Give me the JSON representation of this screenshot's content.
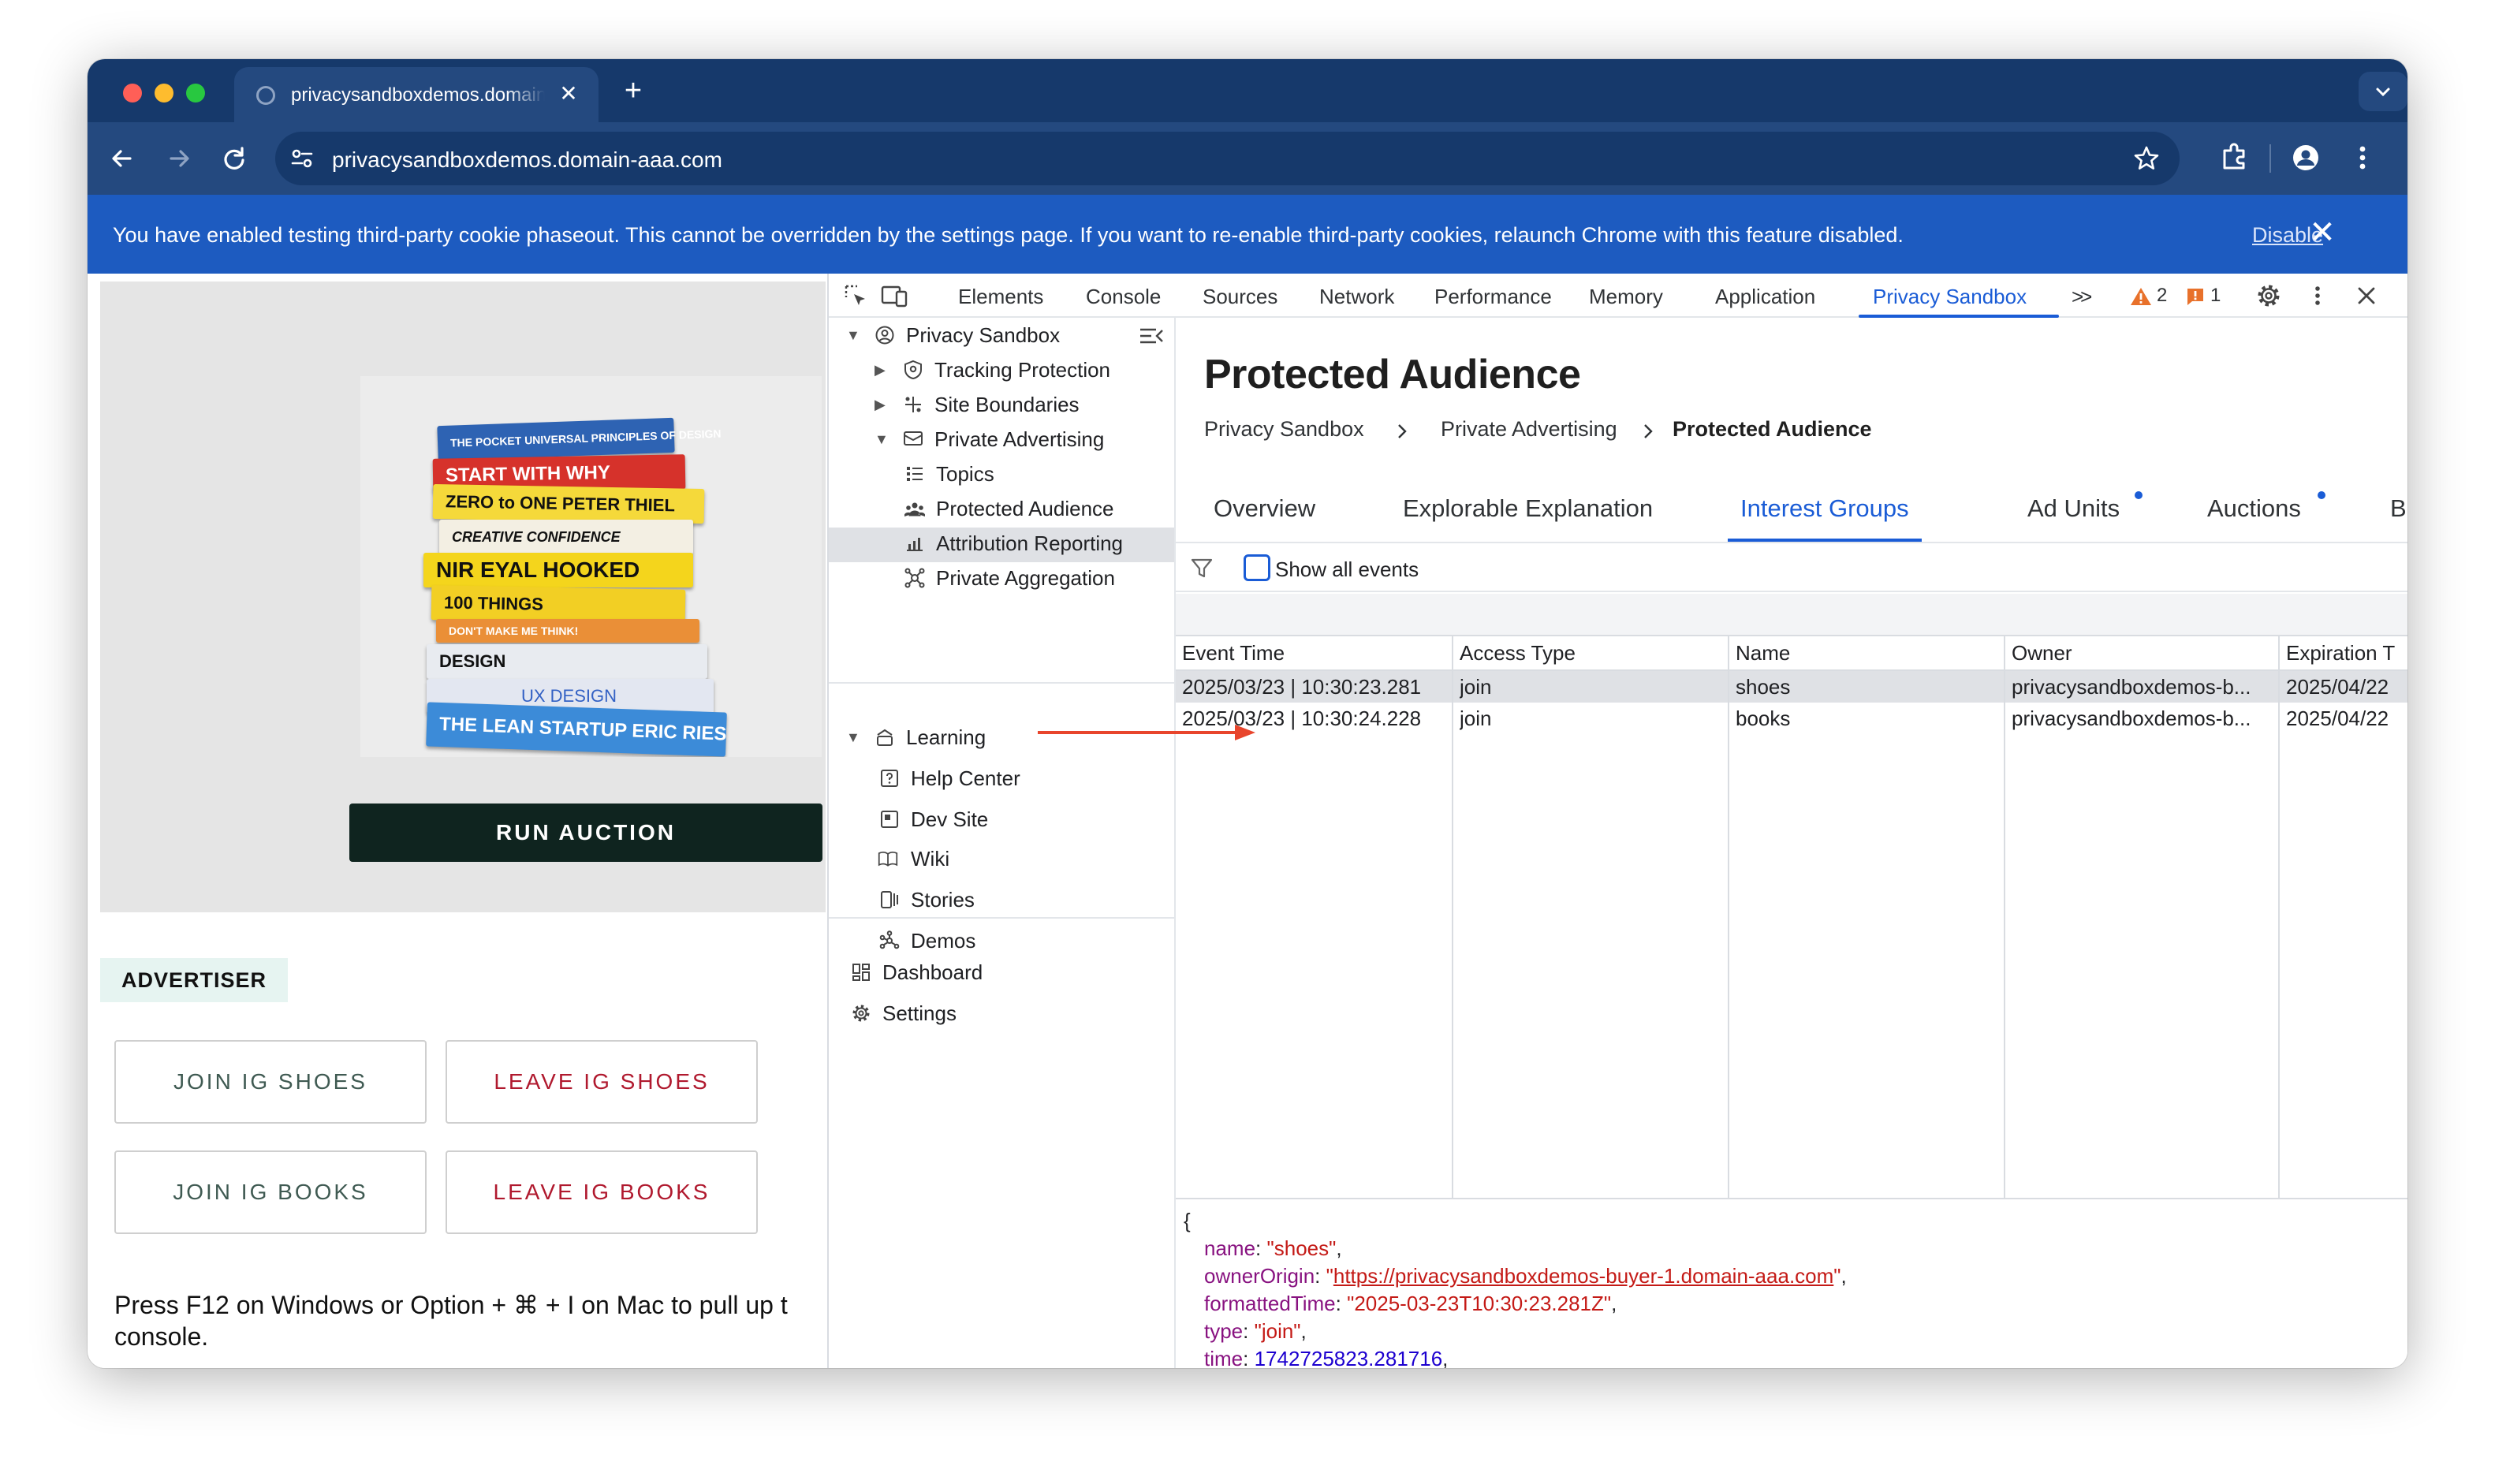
{
  "browser": {
    "tab_title": "privacysandboxdemos.domain-aaa.com",
    "url": "privacysandboxdemos.domain-aaa.com",
    "infobar_text": "You have enabled testing third-party cookie phaseout. This cannot be overridden by the settings page. If you want to re-enable third-party cookies, relaunch Chrome with this feature disabled.",
    "infobar_action": "Disable"
  },
  "page": {
    "books": [
      "THE POCKET UNIVERSAL PRINCIPLES OF DESIGN",
      "START WITH WHY",
      "ZERO to ONE   PETER THIEL",
      "CREATIVE CONFIDENCE",
      "NIR EYAL  HOOKED",
      "100 THINGS",
      "DON'T MAKE ME THINK!",
      "DESIGN",
      "UX DESIGN",
      "THE LEAN STARTUP  ERIC RIES"
    ],
    "run_auction": "RUN AUCTION",
    "advertiser_label": "ADVERTISER",
    "join_shoes": "JOIN IG SHOES",
    "leave_shoes": "LEAVE IG SHOES",
    "join_books": "JOIN IG BOOKS",
    "leave_books": "LEAVE IG BOOKS",
    "help_line1": "Press F12 on Windows or Option + ⌘ + I on Mac to pull up t",
    "help_line2": "console."
  },
  "devtools": {
    "tabs": [
      "Elements",
      "Console",
      "Sources",
      "Network",
      "Performance",
      "Memory",
      "Application",
      "Privacy Sandbox"
    ],
    "more_tabs": ">>",
    "warnings_count": "2",
    "issues_count": "1",
    "sidebar": {
      "root": "Privacy Sandbox",
      "tracking_protection": "Tracking Protection",
      "site_boundaries": "Site Boundaries",
      "private_advertising": "Private Advertising",
      "topics": "Topics",
      "protected_audience": "Protected Audience",
      "attribution_reporting": "Attribution Reporting",
      "private_aggregation": "Private Aggregation",
      "learning": "Learning",
      "help_center": "Help Center",
      "dev_site": "Dev Site",
      "wiki": "Wiki",
      "stories": "Stories",
      "demos": "Demos",
      "dashboard": "Dashboard",
      "settings": "Settings"
    },
    "main": {
      "title": "Protected Audience",
      "breadcrumb": [
        "Privacy Sandbox",
        "Private Advertising",
        "Protected Audience"
      ],
      "tabs": [
        "Overview",
        "Explorable Explanation",
        "Interest Groups",
        "Ad Units",
        "Auctions",
        "Bid"
      ],
      "active_tab": "Interest Groups",
      "show_all_events": "Show all events",
      "columns": [
        "Event Time",
        "Access Type",
        "Name",
        "Owner",
        "Expiration T"
      ],
      "rows": [
        [
          "2025/03/23 | 10:30:23.281",
          "join",
          "shoes",
          "privacysandboxdemos-b...",
          "2025/04/22"
        ],
        [
          "2025/03/23 | 10:30:24.228",
          "join",
          "books",
          "privacysandboxdemos-b...",
          "2025/04/22"
        ]
      ],
      "json": {
        "open_brace": "{",
        "name_key": "name",
        "name_val": "\"shoes\"",
        "owner_key": "ownerOrigin",
        "owner_val": "https://privacysandboxdemos-buyer-1.domain-aaa.com",
        "ftime_key": "formattedTime",
        "ftime_val": "\"2025-03-23T10:30:23.281Z\"",
        "type_key": "type",
        "type_val": "\"join\"",
        "time_key": "time",
        "time_val": "1742725823.281716"
      }
    }
  },
  "colors": {
    "accent": "#1a5cd6",
    "tabstrip": "#16396b",
    "toolbar": "#24497f",
    "infobar": "#1d5bc0",
    "arrow": "#e8452c"
  }
}
